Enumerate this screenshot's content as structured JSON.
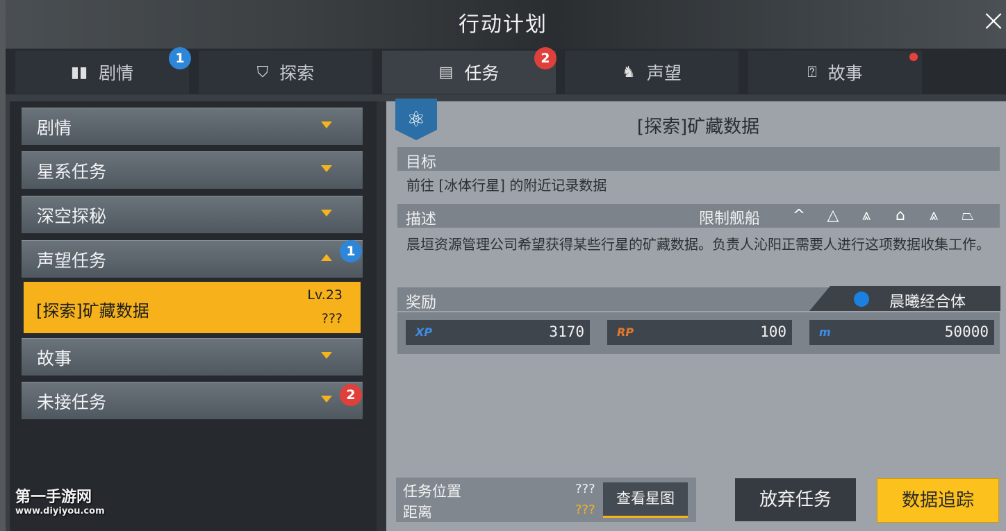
{
  "title": "行动计划",
  "tabs": [
    {
      "label": "剧情",
      "icon": "book-icon"
    },
    {
      "label": "探索",
      "icon": "explore-icon"
    },
    {
      "label": "任务",
      "icon": "task-icon"
    },
    {
      "label": "声望",
      "icon": "reputation-icon"
    },
    {
      "label": "故事",
      "icon": "story-icon"
    }
  ],
  "tab_badges": {
    "story": "1",
    "task": "2"
  },
  "categories": {
    "story": "剧情",
    "galaxy": "星系任务",
    "deep": "深空探秘",
    "rep": "声望任务",
    "tale": "故事",
    "unaccepted": "未接任务"
  },
  "category_badges": {
    "rep": "1",
    "unaccepted": "2"
  },
  "selected_quest": {
    "label": "[探索]矿藏数据",
    "level": "Lv.23",
    "sub": "???"
  },
  "detail": {
    "title": "[探索]矿藏数据",
    "goal_header": "目标",
    "goal_text": "前往 [冰体行星] 的附近记录数据",
    "desc_header": "描述",
    "restrict_label": "限制舰船",
    "ship_icons": [
      "^",
      "△",
      "⩓",
      "⌂",
      "⩓",
      "⏢"
    ],
    "desc_text": "晨垣资源管理公司希望获得某些行星的矿藏数据。负责人沁阳正需要人进行这项数据收集工作。",
    "reward_header": "奖励",
    "corp": "晨曦经合体",
    "rewards": [
      {
        "key": "XP",
        "value": "3170",
        "color": "#3c8ee6"
      },
      {
        "key": "RP",
        "value": "100",
        "color": "#e8782a"
      },
      {
        "key": "m",
        "value": "50000",
        "color": "#3c8ee6"
      }
    ]
  },
  "location": {
    "label1": "任务位置",
    "label2": "距离",
    "value1": "???",
    "value2": "???",
    "starmap_btn": "查看星图"
  },
  "buttons": {
    "abandon": "放弃任务",
    "track": "数据追踪"
  },
  "watermark": {
    "line1": "第一手游网",
    "line2": "www.diyiyou.com"
  },
  "close_icon": "×"
}
